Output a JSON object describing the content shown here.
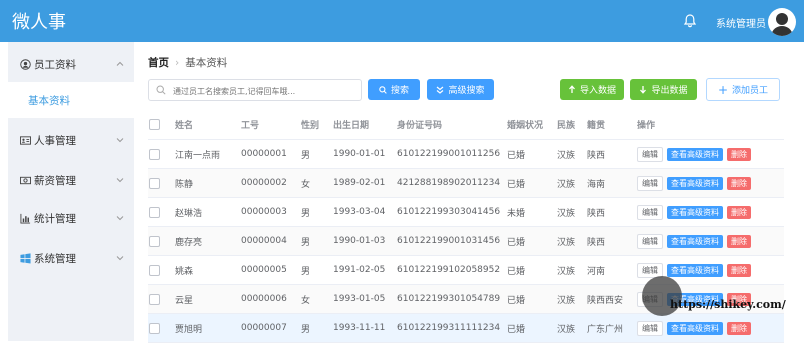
{
  "app": {
    "title": "微人事",
    "user": "系统管理员"
  },
  "sidebar": {
    "items": [
      {
        "label": "员工资料",
        "icon": "user-circle-icon"
      },
      {
        "label": "人事管理",
        "icon": "id-card-icon"
      },
      {
        "label": "薪资管理",
        "icon": "money-icon"
      },
      {
        "label": "统计管理",
        "icon": "bar-chart-icon"
      },
      {
        "label": "系统管理",
        "icon": "windows-icon"
      }
    ],
    "sub_items": [
      {
        "label": "基本资料"
      }
    ]
  },
  "breadcrumb": {
    "home": "首页",
    "current": "基本资料"
  },
  "toolbar": {
    "search_placeholder": "通过员工名搜索员工,记得回车哦...",
    "search_label": "搜索",
    "advanced_label": "高级搜索",
    "import_label": "导入数据",
    "export_label": "导出数据",
    "add_label": "添加员工"
  },
  "table": {
    "headers": [
      "姓名",
      "工号",
      "性别",
      "出生日期",
      "身份证号码",
      "婚姻状况",
      "民族",
      "籍贯",
      "操作"
    ],
    "rows": [
      [
        "江南一点雨",
        "00000001",
        "男",
        "1990-01-01",
        "610122199001011256",
        "已婚",
        "汉族",
        "陕西"
      ],
      [
        "陈静",
        "00000002",
        "女",
        "1989-02-01",
        "421288198902011234",
        "已婚",
        "汉族",
        "海南"
      ],
      [
        "赵琳浩",
        "00000003",
        "男",
        "1993-03-04",
        "610122199303041456",
        "未婚",
        "汉族",
        "陕西"
      ],
      [
        "鹿存亮",
        "00000004",
        "男",
        "1990-01-03",
        "610122199001031456",
        "已婚",
        "汉族",
        "陕西"
      ],
      [
        "姚森",
        "00000005",
        "男",
        "1991-02-05",
        "610122199102058952",
        "已婚",
        "汉族",
        "河南"
      ],
      [
        "云星",
        "00000006",
        "女",
        "1993-01-05",
        "610122199301054789",
        "已婚",
        "汉族",
        "陕西西安"
      ],
      [
        "贾旭明",
        "00000007",
        "男",
        "1993-11-11",
        "610122199311111234",
        "已婚",
        "汉族",
        "广东广州"
      ]
    ],
    "actions": {
      "edit": "编辑",
      "view": "查看高级资料",
      "delete": "删除"
    }
  },
  "watermark": "https://shikey.com/",
  "colors": {
    "header": "#3d9ce0",
    "primary": "#409eff",
    "success": "#67c23a",
    "danger": "#f56c6c"
  }
}
